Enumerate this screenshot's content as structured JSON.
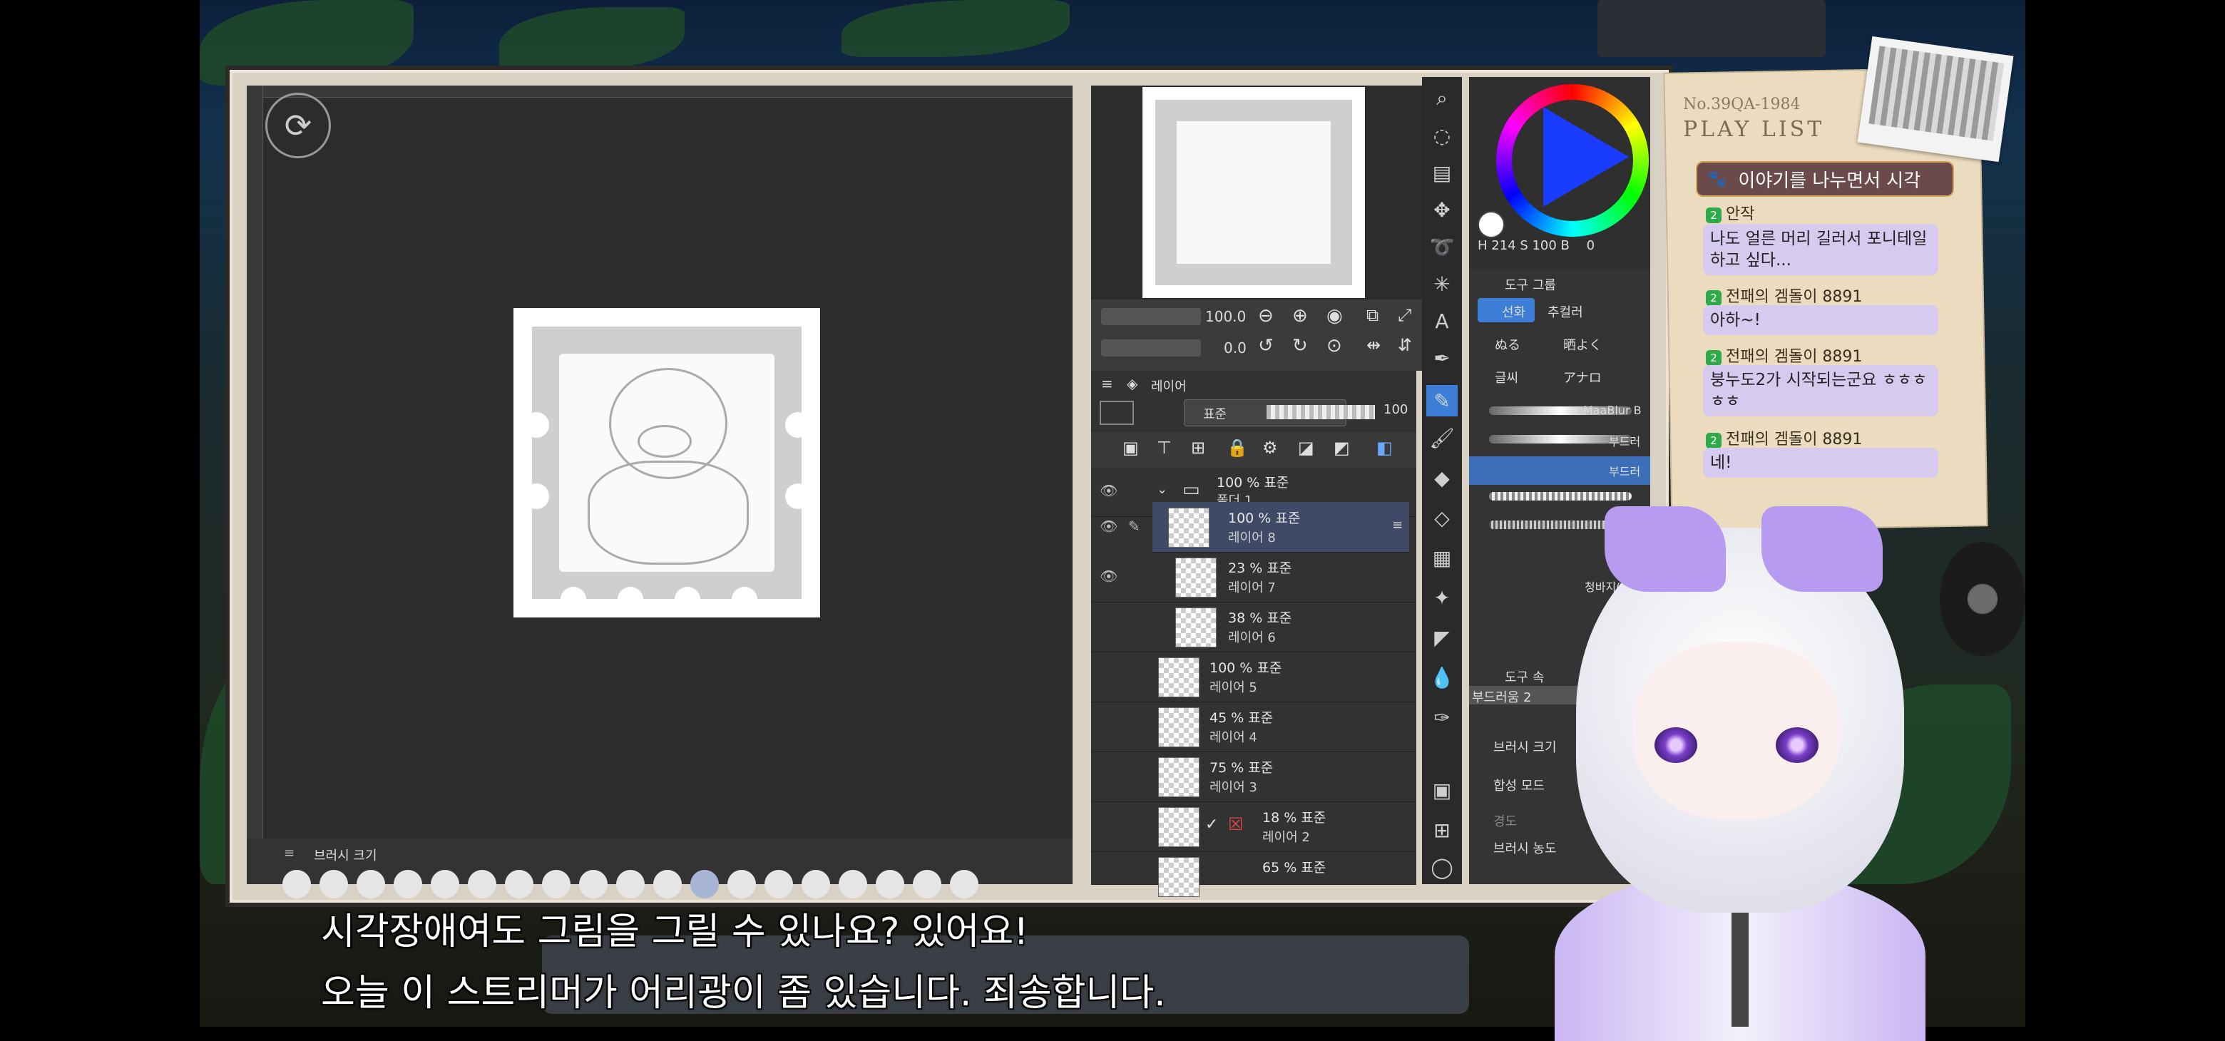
{
  "canvas": {
    "brush_bar_label": "브러시 크기"
  },
  "navigator": {
    "zoom_value": "100.0",
    "angle_value": "0.0"
  },
  "layer_panel": {
    "title": "레이어",
    "blend_mode": "표준",
    "opacity_value": "100",
    "layers": [
      {
        "opacity": "100 % 표준",
        "name": "폴더 1",
        "kind": "folder"
      },
      {
        "opacity": "100 % 표준",
        "name": "레이어 8",
        "selected": true
      },
      {
        "opacity": "23 % 표준",
        "name": "레이어 7"
      },
      {
        "opacity": "38 % 표준",
        "name": "레이어 6"
      },
      {
        "opacity": "100 % 표준",
        "name": "레이어 5"
      },
      {
        "opacity": "45 % 표준",
        "name": "레이어 4"
      },
      {
        "opacity": "75 % 표준",
        "name": "레이어 3"
      },
      {
        "opacity": "18 % 표준",
        "name": "레이어 2"
      },
      {
        "opacity": "65 % 표준",
        "name": ""
      }
    ]
  },
  "color_panel": {
    "readout": "H 214 S 100 B",
    "readout_value": "0"
  },
  "subtool_panel": {
    "header": "도구 그룹",
    "tools": [
      "선화",
      "추컬러",
      "ぬる",
      "晒よく",
      "글씨",
      "アナロ"
    ],
    "brushes": [
      "MaaBlur B",
      "부드러",
      "부드러",
      "청바지(펌"
    ]
  },
  "tool_property": {
    "header": "도구 속",
    "preset": "부드러움 2",
    "brush_size_label": "브러시 크기",
    "blend_mode_label": "합성 모드",
    "hardness_label": "경도",
    "density_label": "브러시 농도"
  },
  "playlist": {
    "number": "No.39QA-1984",
    "title": "PLAY LIST",
    "chat_header": "이야기를 나누면서 시각",
    "messages": [
      {
        "badge": "2",
        "user": "안작",
        "text": "나도 얼른 머리 길러서 포니테일 하고 싶다..."
      },
      {
        "badge": "2",
        "user": "전패의 겜돌이 8891",
        "text": "아하~!"
      },
      {
        "badge": "2",
        "user": "전패의 겜돌이 8891",
        "text": "붕누도2가 시작되는군요 ㅎㅎㅎㅎㅎ"
      },
      {
        "badge": "2",
        "user": "전패의 겜돌이 8891",
        "text": "네!"
      }
    ]
  },
  "subtitles": {
    "line1": "시각장애여도 그림을 그릴 수 있나요? 있어요!",
    "line2": "오늘 이 스트리머가 어리광이 좀 있습니다. 죄송합니다."
  }
}
